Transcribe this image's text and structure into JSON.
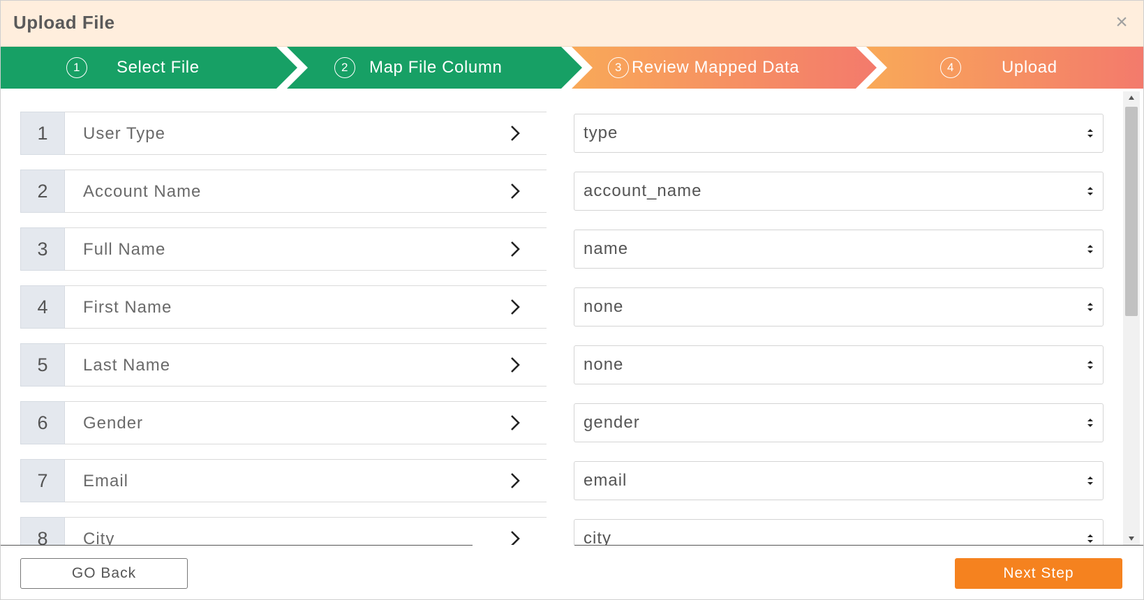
{
  "dialog": {
    "title": "Upload File",
    "close_glyph": "×"
  },
  "stepper": {
    "steps": [
      {
        "number": "1",
        "label": "Select File",
        "state": "completed"
      },
      {
        "number": "2",
        "label": "Map File Column",
        "state": "active"
      },
      {
        "number": "3",
        "label": "Review Mapped Data",
        "state": "pending"
      },
      {
        "number": "4",
        "label": "Upload",
        "state": "pending"
      }
    ],
    "colors": {
      "completed": "#17a065",
      "pending_start": "#f9a958",
      "pending_end": "#f37a6c"
    }
  },
  "mappings": [
    {
      "index": "1",
      "column": "User Type",
      "value": "type"
    },
    {
      "index": "2",
      "column": "Account Name",
      "value": "account_name"
    },
    {
      "index": "3",
      "column": "Full Name",
      "value": "name"
    },
    {
      "index": "4",
      "column": "First Name",
      "value": "none"
    },
    {
      "index": "5",
      "column": "Last Name",
      "value": "none"
    },
    {
      "index": "6",
      "column": "Gender",
      "value": "gender"
    },
    {
      "index": "7",
      "column": "Email",
      "value": "email"
    },
    {
      "index": "8",
      "column": "City",
      "value": "city"
    }
  ],
  "footer": {
    "back_label": "GO Back",
    "next_label": "Next Step",
    "next_color": "#f5821f"
  },
  "icons": {
    "close": "close-icon",
    "row_arrow": "chevron-right-icon",
    "select_caret": "sort-caret-icon",
    "scroll_up": "triangle-up-icon",
    "scroll_down": "triangle-down-icon"
  }
}
